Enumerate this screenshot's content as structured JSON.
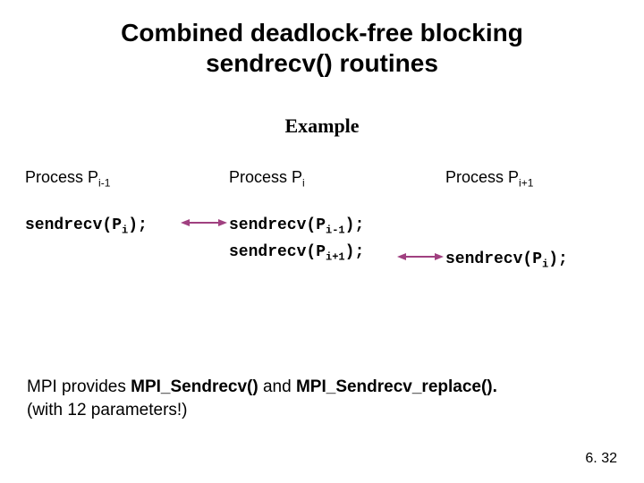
{
  "title_line1": "Combined deadlock-free blocking",
  "title_line2": "sendrecv() routines",
  "example_label": "Example",
  "columns": {
    "left": {
      "proc_prefix": "Process P",
      "proc_sub": "i-1",
      "code1_prefix": "sendrecv(P",
      "code1_sub": "i",
      "code1_suffix": ");"
    },
    "mid": {
      "proc_prefix": "Process P",
      "proc_sub": "i",
      "code1_prefix": "sendrecv(P",
      "code1_sub": "i-1",
      "code1_suffix": ");",
      "code2_prefix": "sendrecv(P",
      "code2_sub": "i+1",
      "code2_suffix": ");"
    },
    "right": {
      "proc_prefix": "Process P",
      "proc_sub": "i+1",
      "code2_prefix": "sendrecv(P",
      "code2_sub": "i",
      "code2_suffix": ");"
    }
  },
  "body": {
    "pre": "MPI provides ",
    "fn1": "MPI_Sendrecv()",
    "mid": " and ",
    "fn2": "MPI_Sendrecv_replace().",
    "line2": "(with 12 parameters!)"
  },
  "page_number": "6. 32",
  "arrow_color": "#a04080"
}
